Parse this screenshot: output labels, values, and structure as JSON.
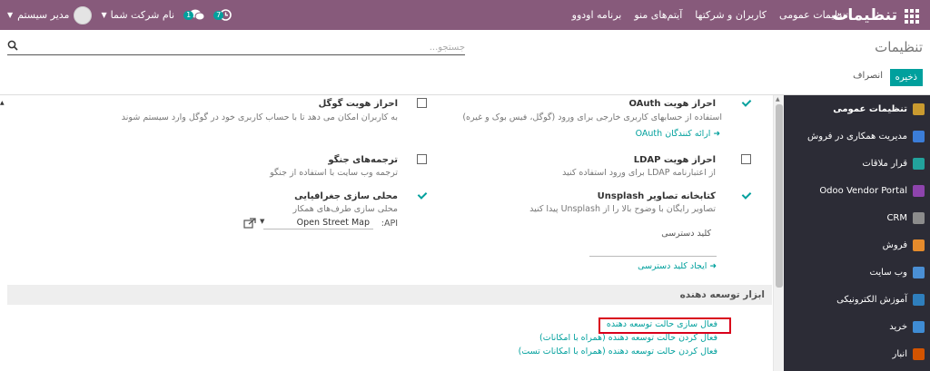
{
  "navbar": {
    "title": "تنظیمات",
    "menu": [
      "تنظیمات عمومی",
      "کاربران و شرکتها",
      "آیتم‌های منو",
      "برنامه اودوو"
    ],
    "company": "نام شرکت شما",
    "user": "مدیر سیستم",
    "chat_count": "1",
    "activity_count": "7"
  },
  "control": {
    "title": "تنظیمات",
    "search_placeholder": "جستجو...",
    "save_label": "ذخیره",
    "discard_label": "انصراف"
  },
  "sidebar": {
    "items": [
      {
        "label": "تنظیمات عمومی",
        "icon": "settings-gear-icon",
        "color": "#c99a2f"
      },
      {
        "label": "مدیریت همکاری در فروش",
        "icon": "partner-icon",
        "color": "#3b7dd8"
      },
      {
        "label": "قرار ملاقات",
        "icon": "calendar-icon",
        "color": "#22a29c"
      },
      {
        "label": "Odoo Vendor Portal",
        "icon": "portal-icon",
        "color": "#8e44ad"
      },
      {
        "label": "CRM",
        "icon": "crm-icon",
        "color": "#8c8c8c"
      },
      {
        "label": "فروش",
        "icon": "sales-icon",
        "color": "#e58b2c"
      },
      {
        "label": "وب سایت",
        "icon": "website-icon",
        "color": "#4a8fd4"
      },
      {
        "label": "آموزش الکترونیکی",
        "icon": "elearning-icon",
        "color": "#2f7fbd"
      },
      {
        "label": "خرید",
        "icon": "purchase-icon",
        "color": "#3f8cd4"
      },
      {
        "label": "انبار",
        "icon": "inventory-icon",
        "color": "#d35400"
      }
    ]
  },
  "settings": {
    "oauth": {
      "title": "احراز هویت OAuth",
      "desc": "استفاده از حسابهای کاربری خارجی برای ورود (گوگل، فیس بوک و غیره)",
      "link": "ارائه کنندگان OAuth"
    },
    "google": {
      "title": "احراز هویت گوگل",
      "desc": "به کاربران امکان می دهد تا با حساب کاربری خود در گوگل وارد سیستم شوند"
    },
    "ldap": {
      "title": "احراز هویت LDAP",
      "desc": "از اعتبارنامه LDAP برای ورود استفاده کنید"
    },
    "geo": {
      "title": "ترجمه‌های جنگو",
      "desc": "ترجمه وب سایت با استفاده از جنگو"
    },
    "unsplash": {
      "title": "کتابخانه تصاویر Unsplash",
      "desc": "تصاویر رایگان با وضوح بالا را از Unsplash پیدا کنید",
      "key_label": "کلید دسترسی",
      "link": "ایجاد کلید دسترسی"
    },
    "geoloc": {
      "title": "محلی سازی جغرافیایی",
      "desc": "محلی سازی طرف‌های همکار",
      "api_label": "API:",
      "api_value": "Open Street Map"
    }
  },
  "developer": {
    "header": "ابزار توسعه دهنده",
    "links": [
      "فعال سازی حالت توسعه دهنده",
      "فعال کردن حالت توسعه دهنده (همراه با امکانات)",
      "فعال کردن حالت توسعه دهنده (همراه با امکانات تست)"
    ]
  },
  "colors": {
    "primary": "#875a7b",
    "accent": "#00a09d",
    "sidebar": "#2c2c36",
    "highlight": "#d9001b"
  }
}
